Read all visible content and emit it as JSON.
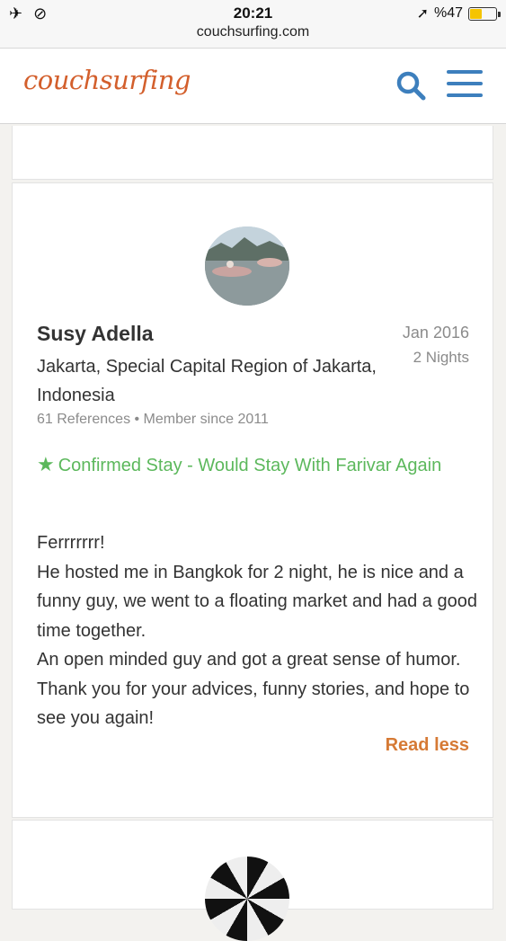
{
  "status_bar": {
    "time": "20:21",
    "url": "couchsurfing.com",
    "battery": "%47",
    "battery_level": 0.47
  },
  "header": {
    "logo": "couchsurfing"
  },
  "reference": {
    "name": "Susy Adella",
    "date": "Jan 2016",
    "nights": "2 Nights",
    "location": "Jakarta, Special Capital Region of Jakarta, Indonesia",
    "meta": "61 References • Member since 2011",
    "confirmed": "Confirmed Stay - Would Stay With Farivar Again",
    "text_lines": [
      "Ferrrrrrr!",
      "He hosted me in Bangkok for 2 night, he is nice and a funny guy, we went to a floating market and had a good time together.",
      "An open minded guy and got a great sense of humor. Thank you for your advices, funny stories, and hope to see you again!"
    ],
    "read_less": "Read less"
  },
  "colors": {
    "brand": "#d35f2c",
    "link": "#3d7fbd",
    "confirmed": "#5cb85c",
    "read_less": "#d67a35"
  }
}
